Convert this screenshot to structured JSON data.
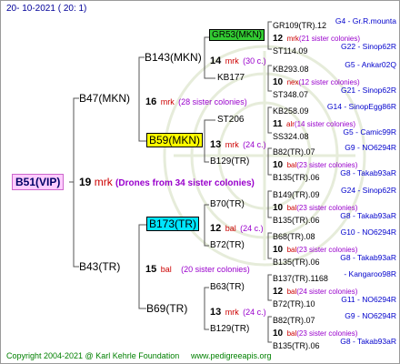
{
  "header": {
    "date": "20- 10-2021 ( 20: 1)"
  },
  "footer": {
    "copyright": "Copyright 2004-2021 @ Karl Kehrle Foundation",
    "site": "www.pedigreeapis.org"
  },
  "colors": {
    "mrk": "#cc0000",
    "bal": "#cc0000",
    "nex": "#cc0000",
    "alr": "#cc0000",
    "sisters": "#9900cc",
    "info": "#0000cc"
  },
  "root": {
    "name": "B51(VIP)",
    "num": "19",
    "breed": "mrk",
    "sisters": "(Drones from 34 sister colonies)"
  },
  "gen1": [
    {
      "name": "B47(MKN)",
      "num": "16",
      "breed": "mrk",
      "sisters": "(28 sister colonies)"
    },
    {
      "name": "B43(TR)",
      "num": "15",
      "breed": "bal",
      "sisters": "(20 sister colonies)"
    }
  ],
  "gen2": [
    {
      "name": "B143(MKN)",
      "num": "14",
      "breed": "mrk",
      "sisters": "(30 c.)"
    },
    {
      "name": "B59(MKN)",
      "num": "13",
      "breed": "mrk",
      "sisters": "(24 c.)"
    },
    {
      "name": "B173(TR)",
      "num": "12",
      "breed": "bal",
      "sisters": "(24 c.)"
    },
    {
      "name": "B69(TR)",
      "num": "13",
      "breed": "mrk",
      "sisters": "(24 c.)"
    }
  ],
  "gen3": [
    "GR53(MKN)",
    "KB177",
    "ST206",
    "B129(TR)",
    "B70(TR)",
    "B72(TR)",
    "B63(TR)",
    "B129(TR)"
  ],
  "gen4": [
    {
      "name": "GR109(TR).12",
      "info": "G4 - Gr.R.mounta"
    },
    {
      "num": "12",
      "breed": "mrk",
      "sisters": "(21 sister colonies)"
    },
    {
      "name": "ST114.09",
      "info": "G22 - Sinop62R"
    },
    {
      "name": "KB293.08",
      "info": "G5 - Ankar02Q"
    },
    {
      "num": "10",
      "breed": "nex",
      "sisters": "(12 sister colonies)"
    },
    {
      "name": "ST348.07",
      "info": "G21 - Sinop62R"
    },
    {
      "name": "KB258.09",
      "info": "G14 - SinopEgg86R"
    },
    {
      "num": "11",
      "breed": "alr",
      "sisters": "(14 sister colonies)"
    },
    {
      "name": "SS324.08",
      "info": "G5 - Camic99R"
    },
    {
      "name": "B82(TR).07",
      "info": "G9 - NO6294R"
    },
    {
      "num": "10",
      "breed": "bal",
      "sisters": "(23 sister colonies)"
    },
    {
      "name": "B135(TR).06",
      "info": "G8 - Takab93aR"
    },
    {
      "name": "B149(TR).09",
      "info": "G24 - Sinop62R"
    },
    {
      "num": "10",
      "breed": "bal",
      "sisters": "(23 sister colonies)"
    },
    {
      "name": "B135(TR).06",
      "info": "G8 - Takab93aR"
    },
    {
      "name": "B68(TR).08",
      "info": "G10 - NO6294R"
    },
    {
      "num": "10",
      "breed": "bal",
      "sisters": "(23 sister colonies)"
    },
    {
      "name": "B135(TR).06",
      "info": "G8 - Takab93aR"
    },
    {
      "name": "B137(TR).1168",
      "info": "- Kangaroo98R"
    },
    {
      "num": "12",
      "breed": "bal",
      "sisters": "(24 sister colonies)"
    },
    {
      "name": "B72(TR).10",
      "info": "G11 - NO6294R"
    },
    {
      "name": "B82(TR).07",
      "info": "G9 - NO6294R"
    },
    {
      "num": "10",
      "breed": "bal",
      "sisters": "(23 sister colonies)"
    },
    {
      "name": "B135(TR).06",
      "info": "G8 - Takab93aR"
    }
  ]
}
